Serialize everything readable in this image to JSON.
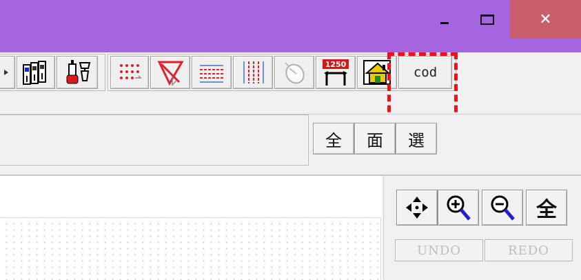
{
  "window": {
    "minimize_icon": "minimize-icon",
    "maximize_icon": "maximize-icon",
    "close_label": "✕",
    "title_color": "#a665e0",
    "close_color": "#c85f6a"
  },
  "toolbar": {
    "icons": [
      "partial-arrow-icon",
      "binders-icon",
      "lamp-tools-icon",
      "dot-grid-icon",
      "triangle-ruler-icon",
      "horizontal-lines-icon",
      "vertical-lines-icon",
      "mouse-icon",
      "scale-icon",
      "house-icon"
    ],
    "scale_label": "1250",
    "cod_label": "cod",
    "highlight_color": "#e8141b"
  },
  "row2": {
    "buttons": [
      "全",
      "面",
      "選"
    ]
  },
  "nav": {
    "icons": [
      "pan-arrows-icon",
      "zoom-in-icon",
      "zoom-out-icon",
      "zoom-all-icon"
    ],
    "zoom_all_label": "全",
    "undo_label": "UNDO",
    "redo_label": "REDO"
  }
}
